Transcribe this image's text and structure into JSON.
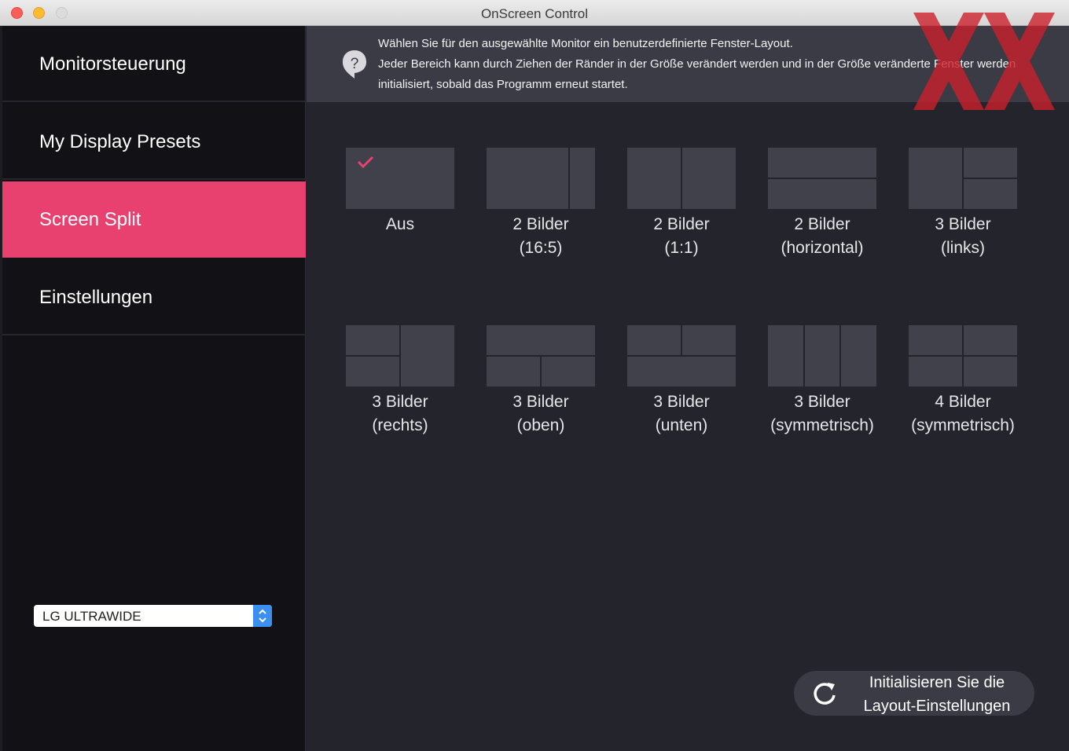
{
  "window": {
    "title": "OnScreen Control"
  },
  "sidebar": {
    "items": [
      {
        "label": "Monitorsteuerung",
        "active": false
      },
      {
        "label": "My Display Presets",
        "active": false
      },
      {
        "label": "Screen Split",
        "active": true
      },
      {
        "label": "Einstellungen",
        "active": false
      }
    ],
    "monitor_select": {
      "value": "LG ULTRAWIDE"
    }
  },
  "info": {
    "icon": "help-icon",
    "lines": [
      "Wählen Sie für den ausgewählte Monitor ein benutzerdefinierte Fenster-Layout.",
      "Jeder Bereich kann durch Ziehen der Ränder in der Größe verändert werden und in der Größe veränderte Fenster werden",
      "initialisiert, sobald das Programm erneut startet."
    ]
  },
  "layouts": [
    {
      "line1": "Aus",
      "line2": "",
      "selected": true
    },
    {
      "line1": "2 Bilder",
      "line2": "(16:5)",
      "selected": false
    },
    {
      "line1": "2 Bilder",
      "line2": "(1:1)",
      "selected": false
    },
    {
      "line1": "2 Bilder",
      "line2": "(horizontal)",
      "selected": false
    },
    {
      "line1": "3 Bilder",
      "line2": "(links)",
      "selected": false
    },
    {
      "line1": "3 Bilder",
      "line2": "(rechts)",
      "selected": false
    },
    {
      "line1": "3 Bilder",
      "line2": "(oben)",
      "selected": false
    },
    {
      "line1": "3 Bilder",
      "line2": "(unten)",
      "selected": false
    },
    {
      "line1": "3 Bilder",
      "line2": "(symmetrisch)",
      "selected": false
    },
    {
      "line1": "4 Bilder",
      "line2": "(symmetrisch)",
      "selected": false
    }
  ],
  "reset": {
    "line1": "Initialisieren Sie die",
    "line2": "Layout-Einstellungen",
    "icon": "refresh-icon"
  },
  "colors": {
    "accent": "#e8406f",
    "sidebar_bg": "#111116",
    "content_bg": "#24242c",
    "tile_bg": "#41414c",
    "select_stepper": "#3b8ff0"
  }
}
